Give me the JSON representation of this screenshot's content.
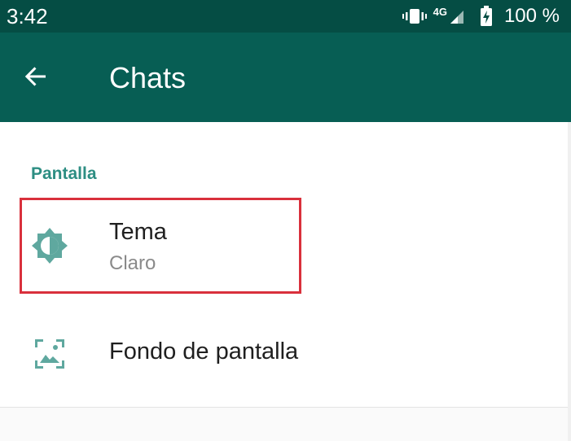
{
  "status_bar": {
    "time": "3:42",
    "network": "4G",
    "battery_percent": "100 %",
    "icons": [
      "vibrate-icon",
      "signal-icon",
      "battery-icon"
    ]
  },
  "app_bar": {
    "title": "Chats",
    "back_icon": "arrow-left-icon"
  },
  "section": {
    "header": "Pantalla"
  },
  "settings": [
    {
      "title": "Tema",
      "subtitle": "Claro",
      "icon": "brightness-icon",
      "highlighted": true
    },
    {
      "title": "Fondo de pantalla",
      "icon": "wallpaper-icon"
    }
  ],
  "colors": {
    "status_bar": "#054d44",
    "app_bar": "#075e54",
    "accent": "#2d8e83",
    "icon": "#5fa89f",
    "highlight": "#d9303c"
  }
}
